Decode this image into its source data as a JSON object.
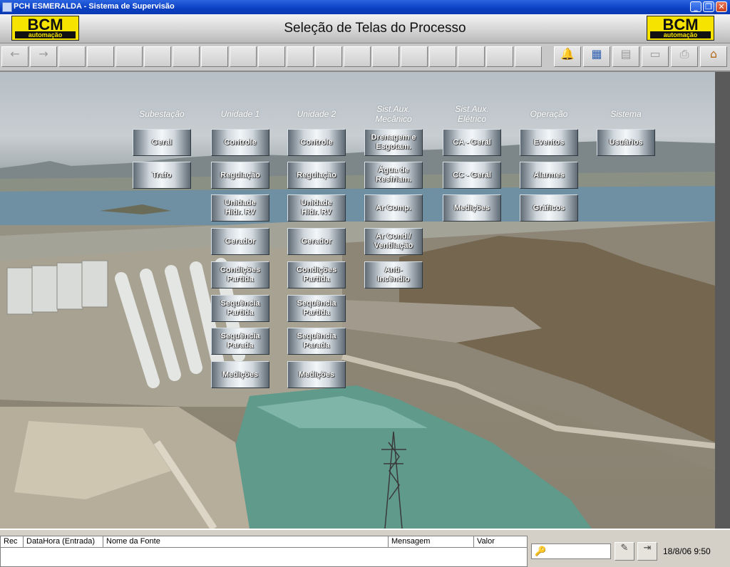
{
  "window": {
    "title": "PCH ESMERALDA - Sistema de Supervisão",
    "controls": {
      "minimize": "_",
      "maximize": "❐",
      "close": "✕"
    }
  },
  "header": {
    "title": "Seleção de Telas do Processo",
    "logo_left": {
      "name": "BCM",
      "tagline": "automação"
    },
    "logo_right": {
      "name": "BCM",
      "tagline": "automação"
    }
  },
  "toolbar": {
    "back_icon": "←",
    "forward_icon": "→",
    "alarm_bell_icon": "🔔",
    "report_icon": "▦",
    "grid_icon": "▤",
    "window_icon": "▭",
    "print_icon": "⎙",
    "home_icon": "⌂"
  },
  "menu": {
    "columns": [
      {
        "title": "Subestação",
        "buttons": [
          "Geral",
          "Trafo"
        ]
      },
      {
        "title": "Unidade 1",
        "buttons": [
          "Controle",
          "Regulação",
          "Unidade\nHidr. RV",
          "Gerador",
          "Condições\nPartida",
          "Sequência\nPartida",
          "Sequência\nParada",
          "Medições"
        ]
      },
      {
        "title": "Unidade 2",
        "buttons": [
          "Controle",
          "Regulação",
          "Unidade\nHidr. RV",
          "Gerador",
          "Condições\nPartida",
          "Sequência\nPartida",
          "Sequência\nParada",
          "Medições"
        ]
      },
      {
        "title": "Sist.Aux.\nMecânico",
        "buttons": [
          "Drenagem e\nEsgotam.",
          "Água de\nResfriam.",
          "Ar Comp.",
          "Ar Cond./\nVentilação",
          "Anti-\nIncêndio"
        ]
      },
      {
        "title": "Sist.Aux.\nElétrico",
        "buttons": [
          "CA - Geral",
          "CC - Geral",
          "Medições"
        ]
      },
      {
        "title": "Operação",
        "buttons": [
          "Eventos",
          "Alarmes",
          "Gráficos"
        ]
      },
      {
        "title": "Sistema",
        "buttons": [
          "Usuários"
        ]
      }
    ]
  },
  "alarm_table": {
    "columns": [
      "Rec",
      "DataHora (Entrada)",
      "Nome da Fonte",
      "Mensagem",
      "Valor"
    ]
  },
  "status": {
    "user_icon": "🔑",
    "login_icon": "✎",
    "logout_icon": "⇥",
    "datetime": "18/8/06 9:50"
  }
}
